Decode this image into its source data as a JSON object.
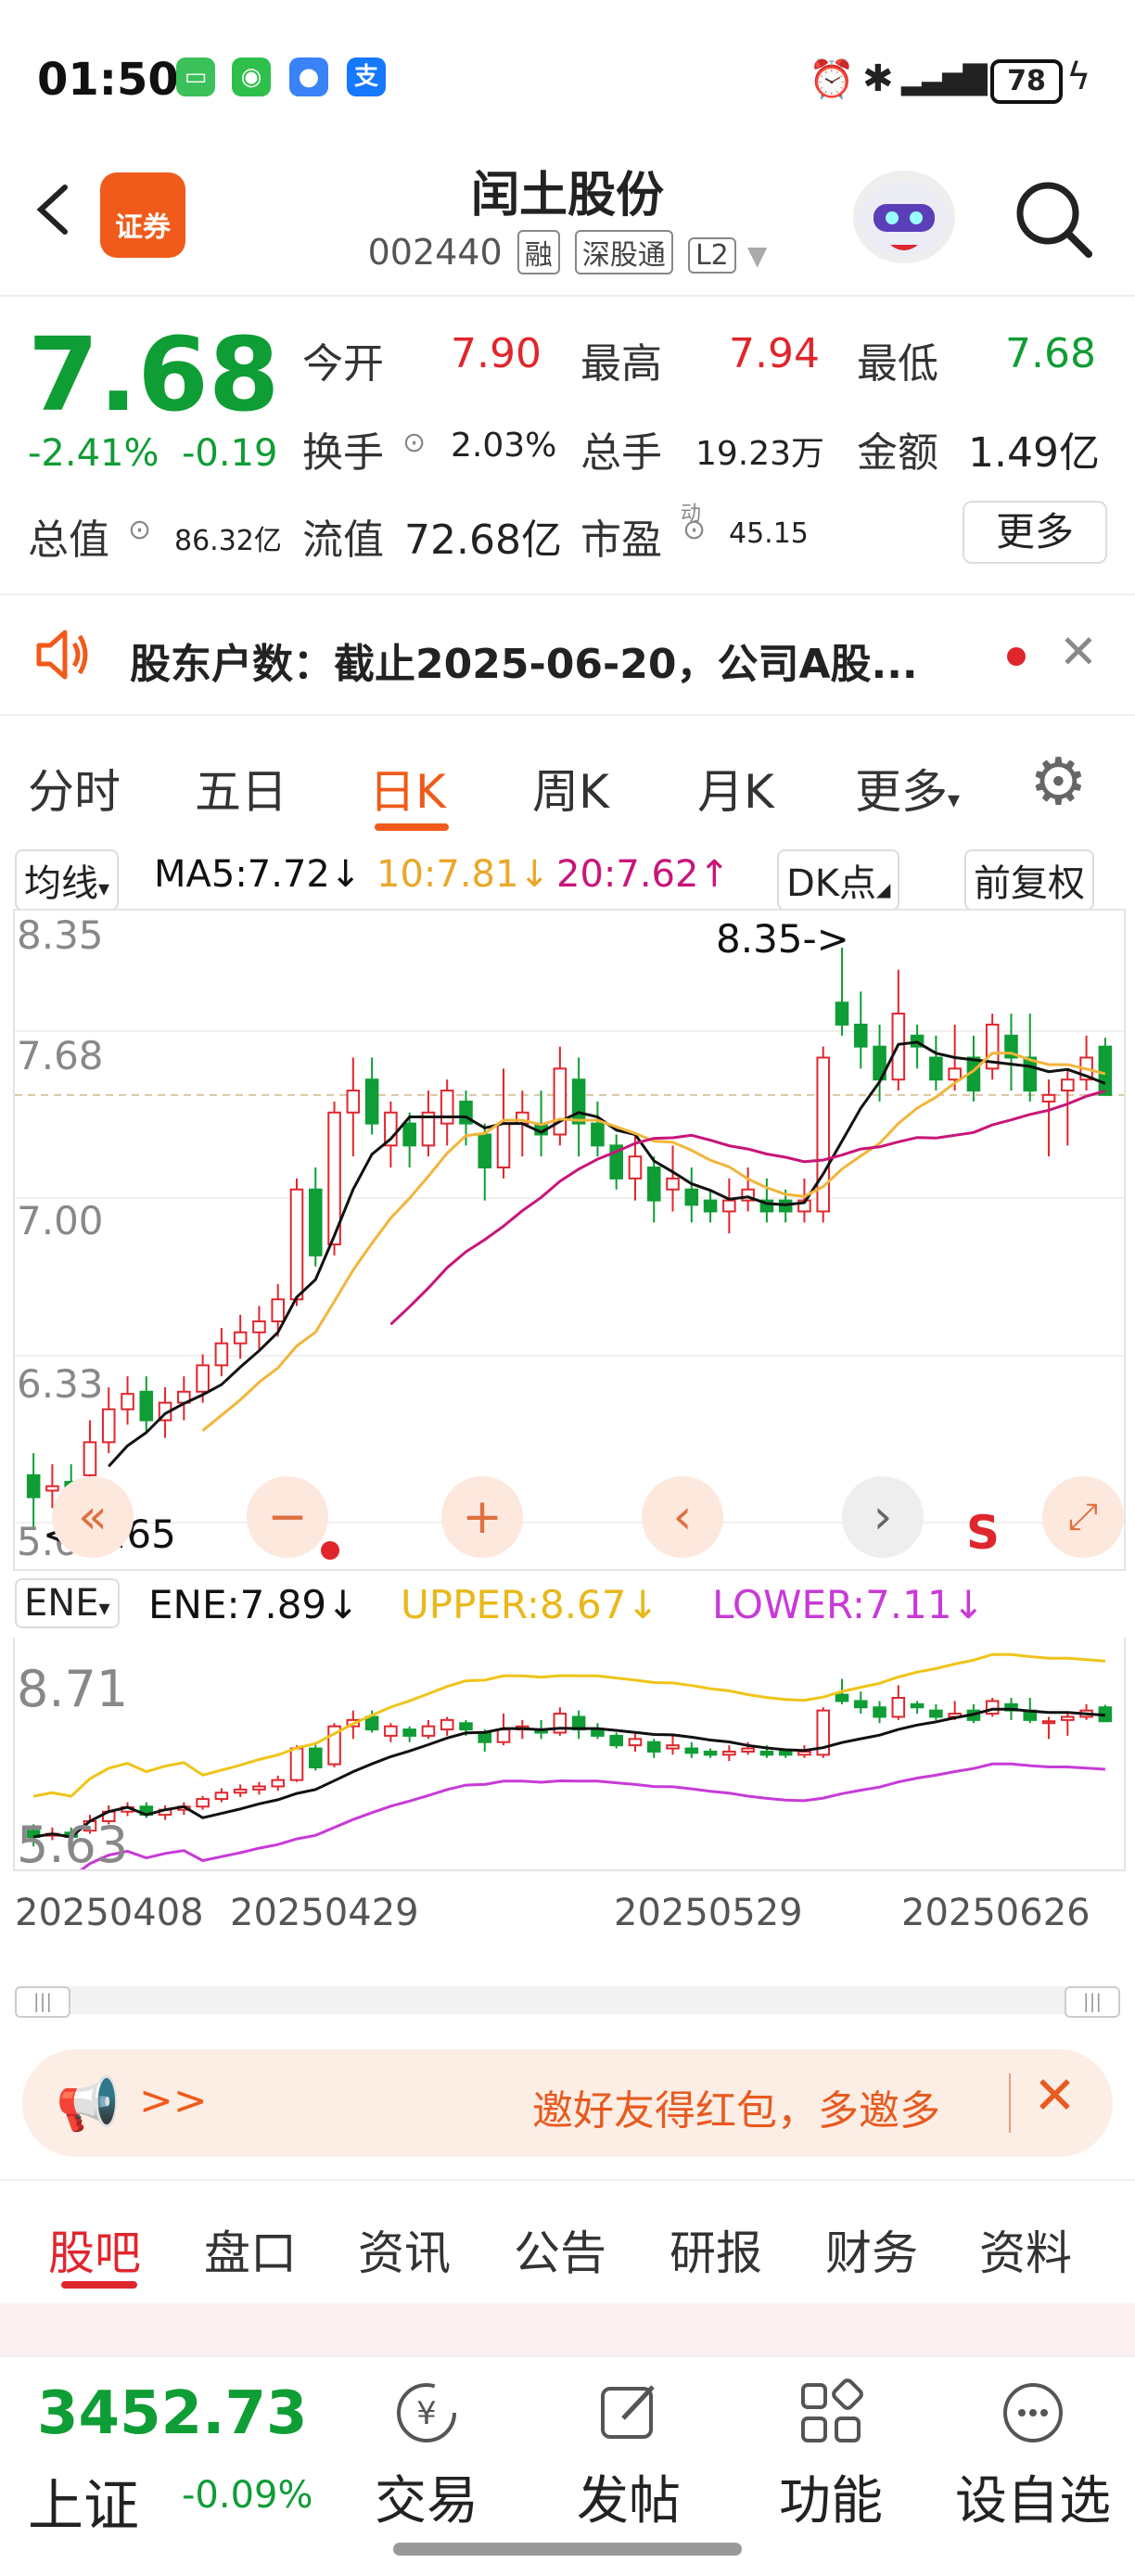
{
  "status_bar": {
    "time": "01:50",
    "battery": "78",
    "apps": [
      {
        "icon": "app-green-icon",
        "glyph": "▭",
        "color": "#3cc05a"
      },
      {
        "icon": "wechat-icon",
        "glyph": "◉",
        "color": "#2fc04c"
      },
      {
        "icon": "message-icon",
        "glyph": "●",
        "color": "#3a82f7"
      },
      {
        "icon": "alipay-icon",
        "glyph": "支",
        "color": "#1677ff"
      }
    ]
  },
  "header": {
    "title": "闰土股份",
    "code": "002440",
    "tags": [
      "融",
      "深股通",
      "L2"
    ],
    "badge": "证券"
  },
  "quote": {
    "price": "7.68",
    "change_pct": "-2.41%",
    "change": "-0.19",
    "open_label": "今开",
    "open": "7.90",
    "high_label": "最高",
    "high": "7.94",
    "low_label": "最低",
    "low": "7.68",
    "turnover_label": "换手",
    "turnover": "2.03%",
    "volume_label": "总手",
    "volume": "19.23万",
    "amount_label": "金额",
    "amount": "1.49亿",
    "mktcap_label": "总值",
    "mktcap": "86.32亿",
    "float_label": "流值",
    "float": "72.68亿",
    "pe_label": "市盈",
    "pe_sup": "动",
    "pe": "45.15",
    "more": "更多"
  },
  "notice": {
    "text": "股东户数：截止2025-06-20，公司A股..."
  },
  "chart_tabs": [
    "分时",
    "五日",
    "日K",
    "周K",
    "月K",
    "更多"
  ],
  "ma": {
    "selector": "均线",
    "ma5": "MA5:7.72↓",
    "ma10": "10:7.81↓",
    "ma20": "20:7.62↑",
    "dk": "DK点",
    "adjust": "前复权"
  },
  "kchart": {
    "y_ticks": [
      "8.35",
      "7.68",
      "7.00",
      "6.33",
      "5.65"
    ],
    "max_marker": "8.35->",
    "min_marker": "<-5.65",
    "signal": "S"
  },
  "ene": {
    "selector": "ENE",
    "ene": "ENE:7.89↓",
    "upper": "UPPER:8.67↓",
    "lower": "LOWER:7.11↓",
    "top": "8.71",
    "bottom": "5.63"
  },
  "dates": [
    "20250408",
    "20250429",
    "20250529",
    "20250626"
  ],
  "promo": {
    "text": "邀好友得红包，多邀多",
    "arrow": ">>"
  },
  "bottom_tabs": [
    "股吧",
    "盘口",
    "资讯",
    "公告",
    "研报",
    "财务",
    "资料"
  ],
  "index": {
    "value": "3452.73",
    "name": "上证",
    "change": "-0.09%"
  },
  "bottom_bar": [
    "交易",
    "发帖",
    "功能",
    "设自选"
  ],
  "colors": {
    "up": "#e0262d",
    "down": "#0f9d35",
    "accent": "#f05a1a",
    "ma5": "#111111",
    "ma10": "#f2b53a",
    "ma20": "#c8157a"
  },
  "chart_data": {
    "type": "candlestick",
    "note_ranges": {
      "price_ylim": [
        5.65,
        8.35
      ],
      "ene_ylim": [
        5.63,
        8.71
      ]
    },
    "candles": [
      [
        5.95,
        5.85,
        6.05,
        5.7
      ],
      [
        5.88,
        5.9,
        6.0,
        5.8
      ],
      [
        5.92,
        5.85,
        6.0,
        5.78
      ],
      [
        5.95,
        6.1,
        6.2,
        5.9
      ],
      [
        6.1,
        6.25,
        6.35,
        6.05
      ],
      [
        6.25,
        6.32,
        6.4,
        6.18
      ],
      [
        6.33,
        6.2,
        6.4,
        6.15
      ],
      [
        6.2,
        6.28,
        6.35,
        6.12
      ],
      [
        6.28,
        6.33,
        6.4,
        6.2
      ],
      [
        6.33,
        6.45,
        6.5,
        6.28
      ],
      [
        6.45,
        6.55,
        6.62,
        6.4
      ],
      [
        6.55,
        6.6,
        6.68,
        6.48
      ],
      [
        6.6,
        6.65,
        6.72,
        6.52
      ],
      [
        6.65,
        6.75,
        6.82,
        6.58
      ],
      [
        6.75,
        7.25,
        7.3,
        6.72
      ],
      [
        7.25,
        6.95,
        7.35,
        6.9
      ],
      [
        7.0,
        7.6,
        7.65,
        6.95
      ],
      [
        7.6,
        7.7,
        7.85,
        7.4
      ],
      [
        7.75,
        7.55,
        7.85,
        7.5
      ],
      [
        7.45,
        7.6,
        7.65,
        7.35
      ],
      [
        7.55,
        7.45,
        7.6,
        7.35
      ],
      [
        7.45,
        7.6,
        7.7,
        7.4
      ],
      [
        7.55,
        7.7,
        7.75,
        7.45
      ],
      [
        7.65,
        7.55,
        7.7,
        7.45
      ],
      [
        7.5,
        7.35,
        7.55,
        7.2
      ],
      [
        7.35,
        7.55,
        7.8,
        7.3
      ],
      [
        7.55,
        7.6,
        7.7,
        7.4
      ],
      [
        7.55,
        7.5,
        7.7,
        7.4
      ],
      [
        7.5,
        7.8,
        7.9,
        7.45
      ],
      [
        7.75,
        7.55,
        7.85,
        7.4
      ],
      [
        7.55,
        7.45,
        7.65,
        7.4
      ],
      [
        7.45,
        7.3,
        7.5,
        7.25
      ],
      [
        7.3,
        7.4,
        7.5,
        7.2
      ],
      [
        7.35,
        7.2,
        7.4,
        7.1
      ],
      [
        7.25,
        7.3,
        7.45,
        7.15
      ],
      [
        7.25,
        7.18,
        7.35,
        7.1
      ],
      [
        7.2,
        7.15,
        7.25,
        7.1
      ],
      [
        7.15,
        7.2,
        7.3,
        7.05
      ],
      [
        7.2,
        7.25,
        7.35,
        7.15
      ],
      [
        7.2,
        7.15,
        7.3,
        7.1
      ],
      [
        7.2,
        7.15,
        7.25,
        7.1
      ],
      [
        7.15,
        7.2,
        7.3,
        7.1
      ],
      [
        7.15,
        7.85,
        7.9,
        7.1
      ],
      [
        8.1,
        8.0,
        8.35,
        7.95
      ],
      [
        8.0,
        7.9,
        8.15,
        7.8
      ],
      [
        7.9,
        7.75,
        8.0,
        7.65
      ],
      [
        7.75,
        8.05,
        8.25,
        7.7
      ],
      [
        7.95,
        7.9,
        8.0,
        7.8
      ],
      [
        7.85,
        7.75,
        7.95,
        7.7
      ],
      [
        7.75,
        7.8,
        8.0,
        7.7
      ],
      [
        7.85,
        7.7,
        7.95,
        7.65
      ],
      [
        7.8,
        8.0,
        8.05,
        7.75
      ],
      [
        7.95,
        7.85,
        8.05,
        7.7
      ],
      [
        7.85,
        7.7,
        8.05,
        7.65
      ],
      [
        7.65,
        7.68,
        7.75,
        7.4
      ],
      [
        7.7,
        7.75,
        7.8,
        7.45
      ],
      [
        7.75,
        7.85,
        7.95,
        7.7
      ],
      [
        7.9,
        7.68,
        7.94,
        7.68
      ]
    ]
  }
}
